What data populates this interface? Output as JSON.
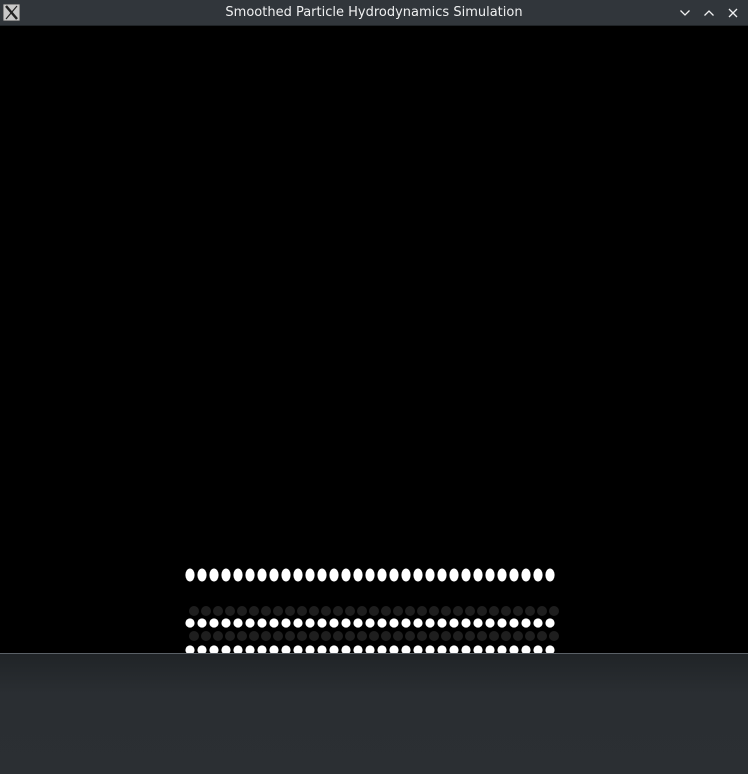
{
  "window": {
    "title": "Smoothed Particle Hydrodynamics Simulation",
    "app_icon": "x11-icon",
    "buttons": [
      "minimize-icon",
      "maximize-icon",
      "close-icon"
    ]
  },
  "simulation": {
    "particle_color": "#ffffff",
    "background_color": "#000000",
    "particles_per_row": 31
  },
  "colors": {
    "titlebar": "#31363b",
    "title_text": "#eff0f1",
    "desktop": "#2a2e32"
  }
}
